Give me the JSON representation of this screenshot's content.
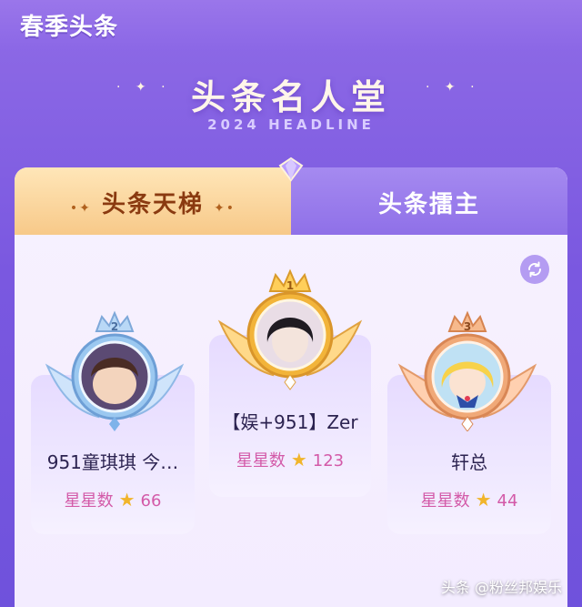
{
  "header": {
    "title": "春季头条"
  },
  "hero": {
    "title": "头条名人堂",
    "subtitle": "2024 HEADLINE"
  },
  "tabs": [
    {
      "label": "头条天梯",
      "active": true
    },
    {
      "label": "头条擂主",
      "active": false
    }
  ],
  "podium": [
    {
      "rank": "2",
      "name": "951童琪琪 今…",
      "stars_label": "星星数",
      "stars": "66",
      "badge": "silver"
    },
    {
      "rank": "1",
      "name": "【娱+951】Zer",
      "stars_label": "星星数",
      "stars": "123",
      "badge": "gold"
    },
    {
      "rank": "3",
      "name": "轩总",
      "stars_label": "星星数",
      "stars": "44",
      "badge": "bronze"
    }
  ],
  "watermark": "头条 @粉丝邦娱乐",
  "colors": {
    "gold": "#f2b43a",
    "silver": "#9bc8f0",
    "bronze": "#f0a978",
    "accent": "#7a58e0"
  },
  "icons": {
    "refresh": "refresh-icon",
    "star": "star-icon",
    "crown": "crown-icon"
  }
}
